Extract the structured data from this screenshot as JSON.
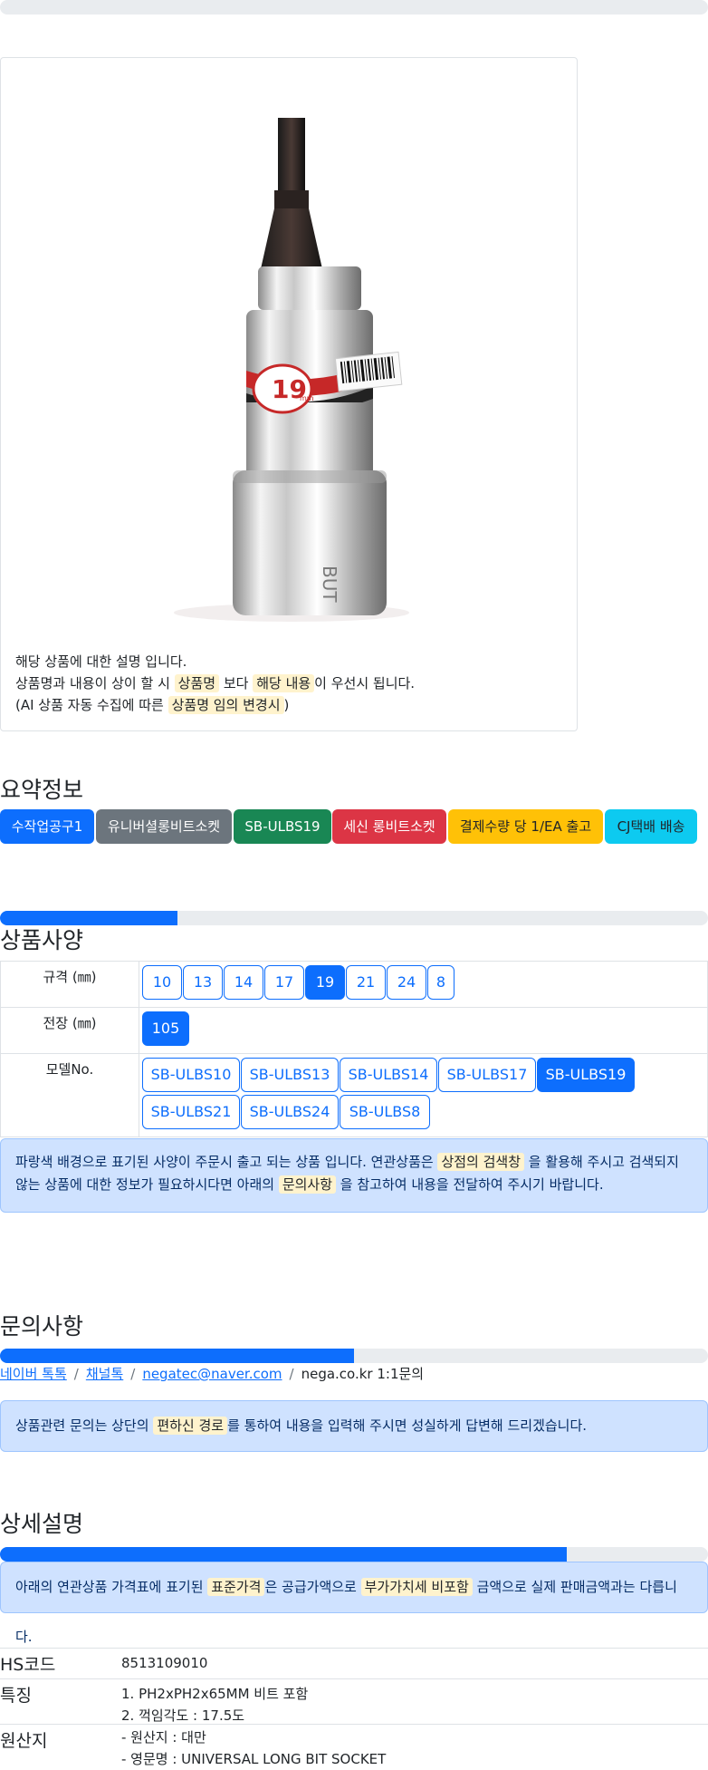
{
  "product": {
    "image_alt": "유니버셜롱비트소켓 SB-ULBS19 product photo",
    "desc_line1": "해당 상품에 대한 설명 입니다.",
    "desc_line2_a": "상품명과 내용이 상이 할 시 ",
    "desc_line2_mark1": "상품명",
    "desc_line2_b": " 보다 ",
    "desc_line2_mark2": "해당 내용",
    "desc_line2_c": "이 우선시 됩니다.",
    "desc_line3_a": "(AI 상품 자동 수집에 따른 ",
    "desc_line3_mark": "상품명 임의 변경시",
    "desc_line3_b": ")",
    "socket_label": "19",
    "socket_unit": "mm"
  },
  "summary": {
    "title": "요약정보",
    "badges": [
      {
        "label": "수작업공구1",
        "color": "#0d6efd"
      },
      {
        "label": "유니버셜롱비트소켓",
        "color": "#6c757d"
      },
      {
        "label": "SB-ULBS19",
        "color": "#198754"
      },
      {
        "label": "세신 롱비트소켓",
        "color": "#dc3545"
      },
      {
        "label": "결제수량 당 1/EA 출고",
        "color": "#ffc107"
      },
      {
        "label": "CJ택배 배송",
        "color": "#0dcaf0"
      }
    ]
  },
  "spec": {
    "progress": 0.25,
    "title": "상품사양",
    "rows": [
      {
        "key": "규격 (㎜)",
        "options": [
          "10",
          "13",
          "14",
          "17",
          "19",
          "21",
          "24",
          "8"
        ],
        "selected": "19"
      },
      {
        "key": "전장 (㎜)",
        "options": [
          "105"
        ],
        "selected": "105"
      },
      {
        "key": "모델No.",
        "options": [
          "SB-ULBS10",
          "SB-ULBS13",
          "SB-ULBS14",
          "SB-ULBS17",
          "SB-ULBS19",
          "SB-ULBS21",
          "SB-ULBS24",
          "SB-ULBS8"
        ],
        "selected": "SB-ULBS19"
      }
    ],
    "notice_a": "파랑색 배경으로 표기된 사양이 주문시 출고 되는 상품 입니다. 연관상품은 ",
    "notice_mark1": "상점의 검색창",
    "notice_b": " 을 활용해 주시고 검색되지 않는 상품에 대한 정보가 필요하시다면 아래의 ",
    "notice_mark2": "문의사항",
    "notice_c": " 을 참고하여 내용을 전달하여 주시기 바랍니다."
  },
  "inquiry": {
    "title": "문의사항",
    "progress": 0.5,
    "links": [
      "네이버 톡톡",
      "채널톡",
      "negatec@naver.com"
    ],
    "plain": "nega.co.kr 1:1문의",
    "separator": "/",
    "notice_a": "상품관련 문의는 상단의 ",
    "notice_mark": "편하신 경로",
    "notice_b": "를 통하여 내용을 입력해 주시면 성실하게 답변해 드리겠습니다."
  },
  "detail": {
    "title": "상세설명",
    "progress": 0.8,
    "notice_a": "아래의 연관상품 가격표에 표기된 ",
    "notice_mark1": "표준가격",
    "notice_b": "은 공급가액으로 ",
    "notice_mark2": "부가가치세 비포함",
    "notice_c": " 금액으로 실제 판매금액과는 다릅니다.",
    "rows": [
      {
        "key": "HS코드",
        "lines": [
          "8513109010"
        ]
      },
      {
        "key": "특징",
        "lines": [
          "1. PH2xPH2x65MM 비트 포함",
          "2. 꺽임각도 : 17.5도"
        ]
      },
      {
        "key": "원산지",
        "lines": [
          "- 원산지 : 대만",
          "- 영문명 : UNIVERSAL LONG BIT SOCKET"
        ]
      }
    ]
  }
}
